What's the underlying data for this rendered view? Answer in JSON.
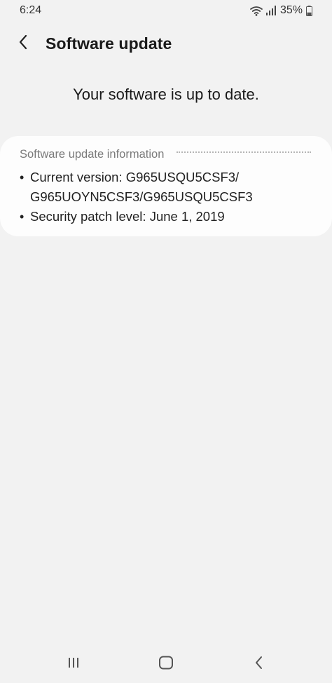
{
  "status_bar": {
    "time": "6:24",
    "battery_percent": "35%",
    "battery_level": 0.35,
    "icons": [
      "wifi-icon",
      "signal-icon",
      "battery-icon"
    ]
  },
  "header": {
    "title": "Software update",
    "back_icon": "chevron-left-icon"
  },
  "status_message": "Your software is up to date.",
  "info_card": {
    "heading": "Software update information",
    "items": [
      {
        "text": "Current version: G965USQU5CSF3/\nG965UOYN5CSF3/G965USQU5CSF3"
      },
      {
        "text": "Security patch level: June 1, 2019"
      }
    ]
  },
  "nav_bar": {
    "icons": [
      "recent-apps-icon",
      "home-icon",
      "back-icon"
    ]
  },
  "colors": {
    "background": "#f2f2f2",
    "card": "#fdfdfd",
    "heading": "#7a7a7a",
    "text": "#1a1a1a"
  }
}
